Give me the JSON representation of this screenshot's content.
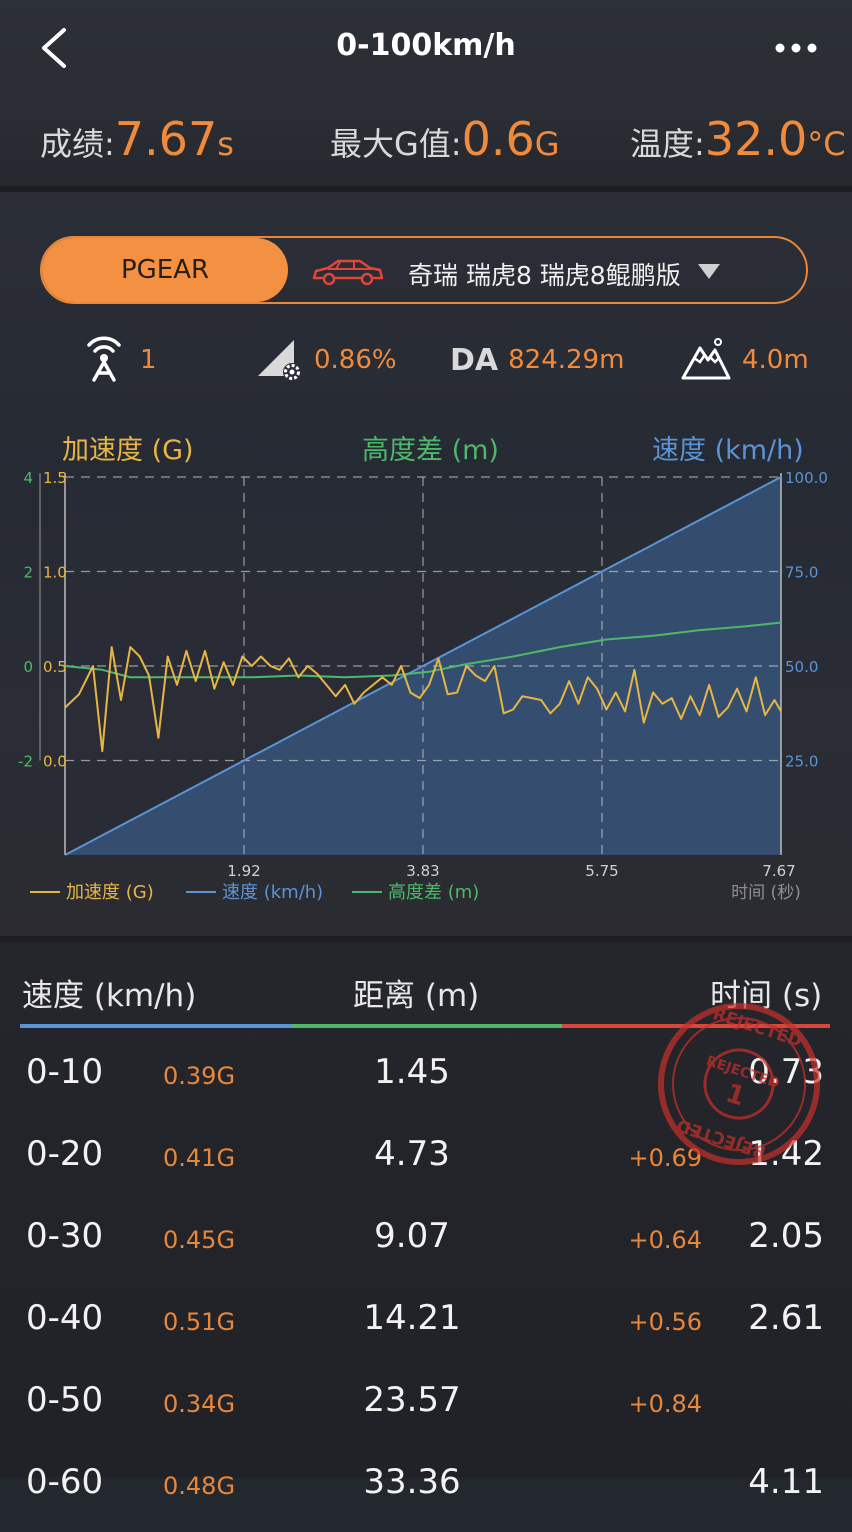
{
  "header": {
    "title": "0-100km/h",
    "stats": [
      {
        "label": "成绩:",
        "value": "7.67",
        "unit": "s"
      },
      {
        "label": "最大G值:",
        "value": "0.6",
        "unit": "G"
      },
      {
        "label": "温度:",
        "value": "32.0",
        "unit": "°C"
      }
    ]
  },
  "selector": {
    "brand": "PGEAR",
    "car": "奇瑞 瑞虎8 瑞虎8鲲鹏版"
  },
  "metrics": {
    "satellites": "1",
    "slope": "0.86%",
    "da_label": "DA",
    "da_value": "824.29m",
    "elevation": "4.0m"
  },
  "colors": {
    "accent": "#f08a3c",
    "accel": "#e6b545",
    "speed": "#5a94d6",
    "height": "#4db86a",
    "red": "#d8473c"
  },
  "chart_data": {
    "type": "line",
    "axis_titles": {
      "left": "加速度 (G)",
      "middle": "高度差 (m)",
      "right": "速度 (km/h)"
    },
    "x_ticks": [
      "1.92",
      "3.83",
      "5.75",
      "7.67"
    ],
    "x_label": "时间 (秒)",
    "xlim": [
      0,
      7.67
    ],
    "left_outer_ticks": [
      "4",
      "2",
      "0",
      "-2"
    ],
    "left_inner_ticks": [
      "1.5",
      "1.0",
      "0.5",
      "0.0"
    ],
    "right_ticks": [
      "100.0",
      "75.0",
      "50.0",
      "25.0"
    ],
    "legend": [
      "加速度 (G)",
      "速度 (km/h)",
      "高度差 (m)"
    ],
    "speed": {
      "x": [
        0,
        7.67
      ],
      "y": [
        0,
        100
      ]
    },
    "height": {
      "x": [
        0,
        0.4,
        0.7,
        1.0,
        1.5,
        2.0,
        2.5,
        3.0,
        3.5,
        3.9,
        4.3,
        4.8,
        5.3,
        5.8,
        6.3,
        6.8,
        7.3,
        7.67
      ],
      "y": [
        0.5,
        0.48,
        0.44,
        0.44,
        0.44,
        0.44,
        0.45,
        0.44,
        0.45,
        0.47,
        0.51,
        0.55,
        0.6,
        0.64,
        0.66,
        0.69,
        0.71,
        0.73
      ]
    },
    "accel": {
      "x": [
        0,
        0.15,
        0.3,
        0.4,
        0.5,
        0.6,
        0.7,
        0.8,
        0.9,
        1.0,
        1.1,
        1.2,
        1.3,
        1.4,
        1.5,
        1.6,
        1.7,
        1.8,
        1.9,
        2.0,
        2.1,
        2.2,
        2.3,
        2.4,
        2.5,
        2.6,
        2.7,
        2.8,
        2.9,
        3.0,
        3.1,
        3.2,
        3.3,
        3.4,
        3.5,
        3.6,
        3.7,
        3.8,
        3.9,
        4.0,
        4.1,
        4.2,
        4.3,
        4.4,
        4.5,
        4.6,
        4.7,
        4.8,
        4.9,
        5.0,
        5.1,
        5.2,
        5.3,
        5.4,
        5.5,
        5.6,
        5.7,
        5.8,
        5.9,
        6.0,
        6.1,
        6.2,
        6.3,
        6.4,
        6.5,
        6.6,
        6.7,
        6.8,
        6.9,
        7.0,
        7.1,
        7.2,
        7.3,
        7.4,
        7.5,
        7.6,
        7.67
      ],
      "y": [
        0.28,
        0.35,
        0.5,
        0.05,
        0.6,
        0.32,
        0.6,
        0.55,
        0.45,
        0.12,
        0.55,
        0.4,
        0.58,
        0.42,
        0.58,
        0.38,
        0.52,
        0.4,
        0.55,
        0.5,
        0.55,
        0.5,
        0.48,
        0.54,
        0.44,
        0.5,
        0.46,
        0.4,
        0.34,
        0.4,
        0.3,
        0.36,
        0.4,
        0.44,
        0.4,
        0.5,
        0.36,
        0.33,
        0.4,
        0.54,
        0.35,
        0.36,
        0.5,
        0.45,
        0.42,
        0.5,
        0.25,
        0.27,
        0.34,
        0.33,
        0.32,
        0.25,
        0.3,
        0.42,
        0.3,
        0.44,
        0.38,
        0.27,
        0.36,
        0.26,
        0.48,
        0.2,
        0.36,
        0.3,
        0.33,
        0.22,
        0.34,
        0.24,
        0.4,
        0.23,
        0.28,
        0.38,
        0.26,
        0.44,
        0.24,
        0.32,
        0.26
      ]
    }
  },
  "table": {
    "headers": {
      "speed": "速度 (km/h)",
      "distance": "距离 (m)",
      "time": "时间 (s)"
    },
    "rows": [
      {
        "speed": "0-10",
        "g": "0.39G",
        "distance": "1.45",
        "delta": "",
        "time": "0.73"
      },
      {
        "speed": "0-20",
        "g": "0.41G",
        "distance": "4.73",
        "delta": "+0.69",
        "time": "1.42"
      },
      {
        "speed": "0-30",
        "g": "0.45G",
        "distance": "9.07",
        "delta": "+0.64",
        "time": "2.05"
      },
      {
        "speed": "0-40",
        "g": "0.51G",
        "distance": "14.21",
        "delta": "+0.56",
        "time": "2.61"
      },
      {
        "speed": "0-50",
        "g": "0.34G",
        "distance": "23.57",
        "delta": "+0.84",
        "time": ""
      },
      {
        "speed": "0-60",
        "g": "0.48G",
        "distance": "33.36",
        "delta": "",
        "time": "4.11"
      }
    ]
  },
  "stamp": {
    "text": "REJECTED",
    "number": "1"
  }
}
